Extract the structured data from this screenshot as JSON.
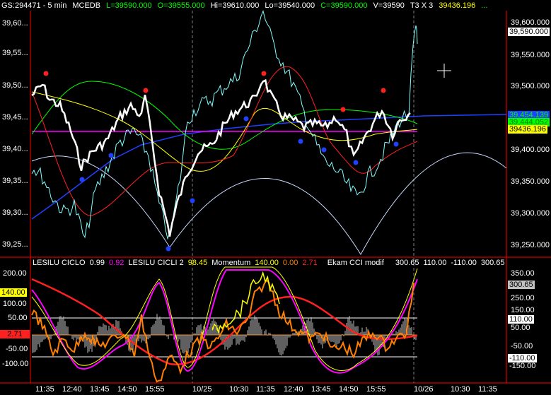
{
  "header": {
    "symbol": "GS:294471 - 5 min",
    "exchange": "MCEDB",
    "last": "L=39590.000",
    "open": "O=39555.000",
    "high": "Hi=39610.000",
    "low": "Lo=39540.000",
    "close": "C=39590.000",
    "volume": "V=39590",
    "mode": "T3 X 3",
    "avg": "39436.196",
    "dots": "..."
  },
  "colors": {
    "green": "#00ff00",
    "yellow": "#ffff00",
    "magenta": "#ff00ff",
    "red": "#ff2020",
    "cyan": "#80ffff",
    "orange": "#ff8000",
    "blue": "#2040ff",
    "white": "#ffffff",
    "gray": "#c0c0c0",
    "grid": "#808080"
  },
  "price_panel": {
    "right_axis": [
      "39,600.000",
      "39,550.000",
      "39,500.000",
      "39,400.000",
      "39,350.000",
      "39,300.000",
      "39,250.000"
    ],
    "left_axis": [
      "39,60...",
      "39,55...",
      "39,50...",
      "39,45...",
      "39,40...",
      "39,35...",
      "39,30...",
      "39,25..."
    ],
    "last_price_tag": "39,590.000",
    "value_tags": [
      "39,454.139",
      "39,444.052",
      "39436.196"
    ]
  },
  "indicator_panel": {
    "legend": {
      "c1_name": "LESILU CICLO",
      "c1_v1": "0.99",
      "c1_v2": "0.92",
      "c2_name": "LESILU CICLI 2",
      "c2_v": "98.45",
      "mom_name": "Momentum",
      "mom_v1": "140.00",
      "mom_v2": "0.00",
      "mom_v3": "2.71",
      "cci_name": "Ekam CCI modif",
      "cci_v1": "300.65",
      "cci_v2": "110.00",
      "cci_v3": "-110.00",
      "cci_v4": "300.65"
    },
    "left_axis": [
      "200.00",
      "100.00",
      "50.00",
      "-50.00",
      "-100.00"
    ],
    "right_axis": [
      "350.00",
      "250.00",
      "150.00",
      "50.00",
      "-50.00",
      "-150.00"
    ],
    "left_tags": [
      "140.00",
      "2.71"
    ],
    "right_tags": [
      "300.65",
      "110.00",
      "-110.00"
    ]
  },
  "time_axis": [
    "11:35",
    "12:40",
    "13:45",
    "14:50",
    "15:55",
    "10/25",
    "10:30",
    "11:35",
    "12:40",
    "13:45",
    "14:50",
    "15:55",
    "10/26",
    "10:30",
    "11:35"
  ]
}
